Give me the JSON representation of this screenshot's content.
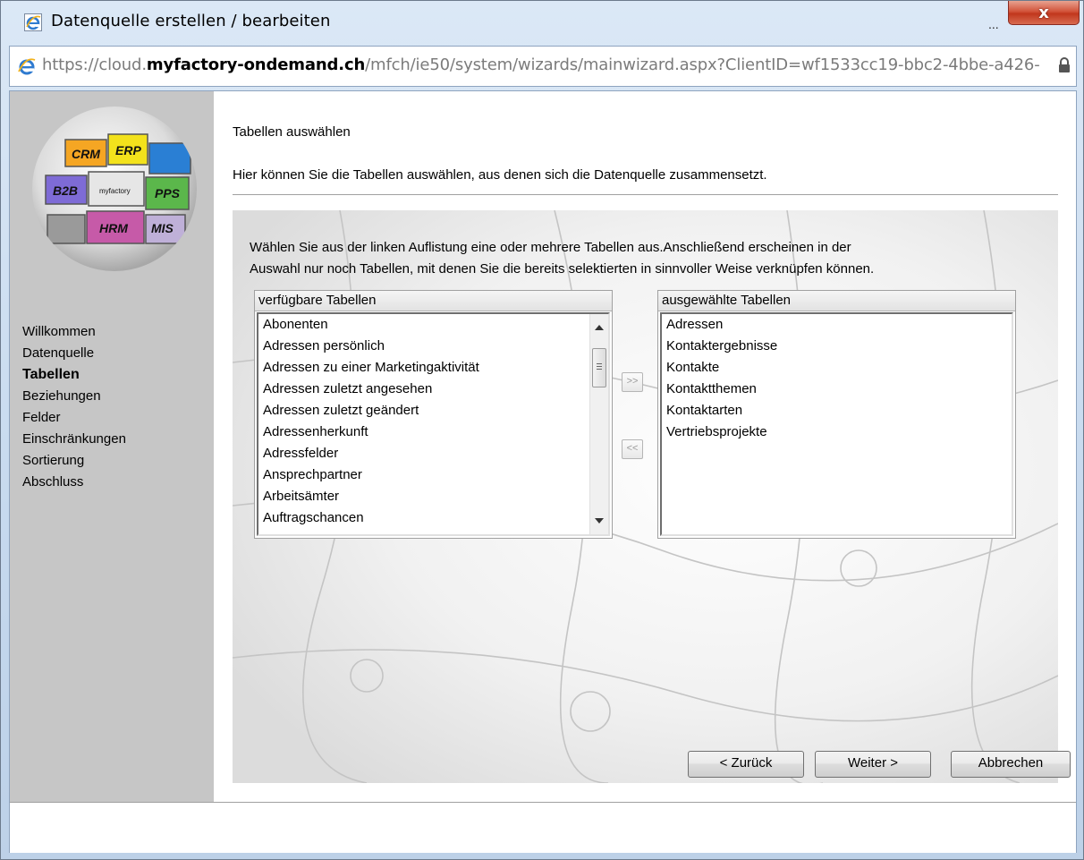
{
  "window": {
    "title": "Datenquelle erstellen / bearbeiten",
    "title_ellipsis": "...",
    "close_label": "x"
  },
  "address": {
    "url_prefix": "https://cloud.",
    "url_domain": "myfactory-ondemand.ch",
    "url_path": "/mfch/ie50/system/wizards/mainwizard.aspx?ClientID=wf1533cc19-bbc2-4bbe-a426-"
  },
  "logo": {
    "tiles": [
      "CRM",
      "ERP",
      "B2B",
      "myfactory",
      "PPS",
      "HRM",
      "MIS"
    ]
  },
  "sidebar": {
    "items": [
      {
        "label": "Willkommen",
        "active": false
      },
      {
        "label": "Datenquelle",
        "active": false
      },
      {
        "label": "Tabellen",
        "active": true
      },
      {
        "label": "Beziehungen",
        "active": false
      },
      {
        "label": "Felder",
        "active": false
      },
      {
        "label": "Einschränkungen",
        "active": false
      },
      {
        "label": "Sortierung",
        "active": false
      },
      {
        "label": "Abschluss",
        "active": false
      }
    ]
  },
  "main": {
    "heading": "Tabellen auswählen",
    "subheading": "Hier können Sie die Tabellen auswählen, aus denen sich die Datenquelle zusammensetzt.",
    "instruction_line1": "Wählen Sie aus der linken Auflistung eine oder mehrere Tabellen aus.Anschließend erscheinen in der",
    "instruction_line2": "Auswahl nur noch Tabellen, mit denen Sie die bereits selektierten in sinnvoller Weise verknüpfen können."
  },
  "available": {
    "header": "verfügbare Tabellen",
    "items": [
      "Abonenten",
      "Adressen persönlich",
      "Adressen zu einer Marketingaktivität",
      "Adressen zuletzt angesehen",
      "Adressen zuletzt geändert",
      "Adressenherkunft",
      "Adressfelder",
      "Ansprechpartner",
      "Arbeitsämter",
      "Auftragschancen"
    ]
  },
  "selected": {
    "header": "ausgewählte Tabellen",
    "items": [
      "Adressen",
      "Kontaktergebnisse",
      "Kontakte",
      "Kontaktthemen",
      "Kontaktarten",
      "Vertriebsprojekte"
    ]
  },
  "transfer": {
    "add_label": ">>",
    "remove_label": "<<"
  },
  "footer": {
    "back_label": "< Zurück",
    "next_label": "Weiter >",
    "cancel_label": "Abbrechen"
  }
}
